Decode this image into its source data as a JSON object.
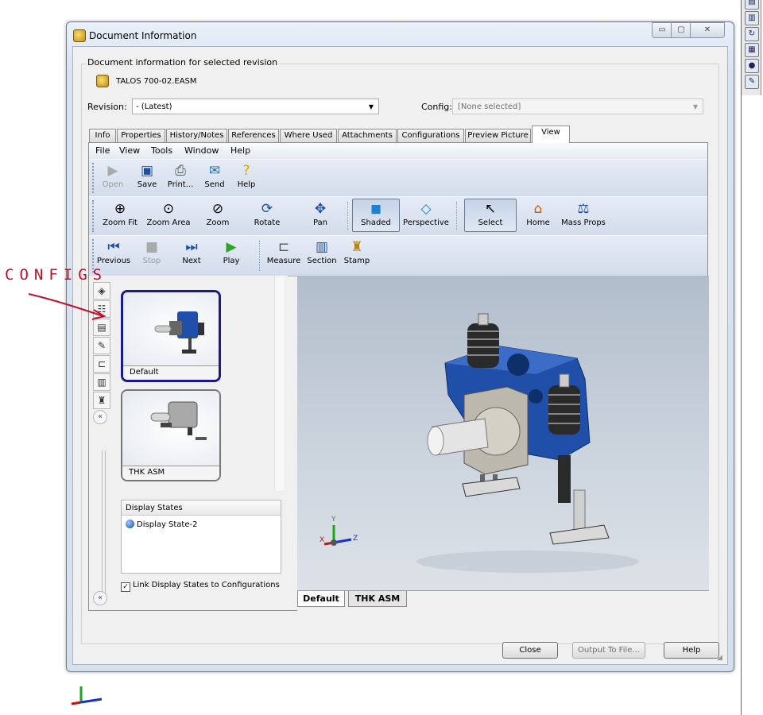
{
  "dialog": {
    "title": "Document Information",
    "group_label": "Document information for selected revision",
    "document_name": "TALOS 700-02.EASM",
    "revision": {
      "label": "Revision:",
      "value": "- (Latest)"
    },
    "config": {
      "label": "Config:",
      "value": "[None selected]"
    },
    "tabs": [
      "Info",
      "Properties",
      "History/Notes",
      "References",
      "Where Used",
      "Attachments",
      "Configurations",
      "Preview Picture",
      "View"
    ],
    "active_tab": "View"
  },
  "viewer": {
    "menu": [
      "File",
      "View",
      "Tools",
      "Window",
      "Help"
    ],
    "toolbar1": [
      "Open",
      "Save",
      "Print...",
      "Send",
      "Help"
    ],
    "toolbar2": [
      "Zoom Fit",
      "Zoom Area",
      "Zoom",
      "Rotate",
      "Pan",
      "Shaded",
      "Perspective",
      "Select",
      "Home",
      "Mass Props"
    ],
    "toolbar3": [
      "Previous",
      "Stop",
      "Next",
      "Play",
      "Measure",
      "Section",
      "Stamp"
    ],
    "configurations": [
      "Default",
      "THK ASM"
    ],
    "display_states_header": "Display States",
    "display_state": "Display State-2",
    "link_checkbox": "Link Display States to Configurations",
    "view_tabs": [
      "Default",
      "THK ASM"
    ],
    "triad": {
      "x": "X",
      "y": "Y",
      "z": "Z"
    }
  },
  "buttons": {
    "close": "Close",
    "output": "Output To File...",
    "help": "Help"
  },
  "annotation": "CONFIGS",
  "colors": {
    "accent": "#1a1a8a",
    "model_blue": "#1f4fa8",
    "annotation_red": "#c0102a"
  }
}
